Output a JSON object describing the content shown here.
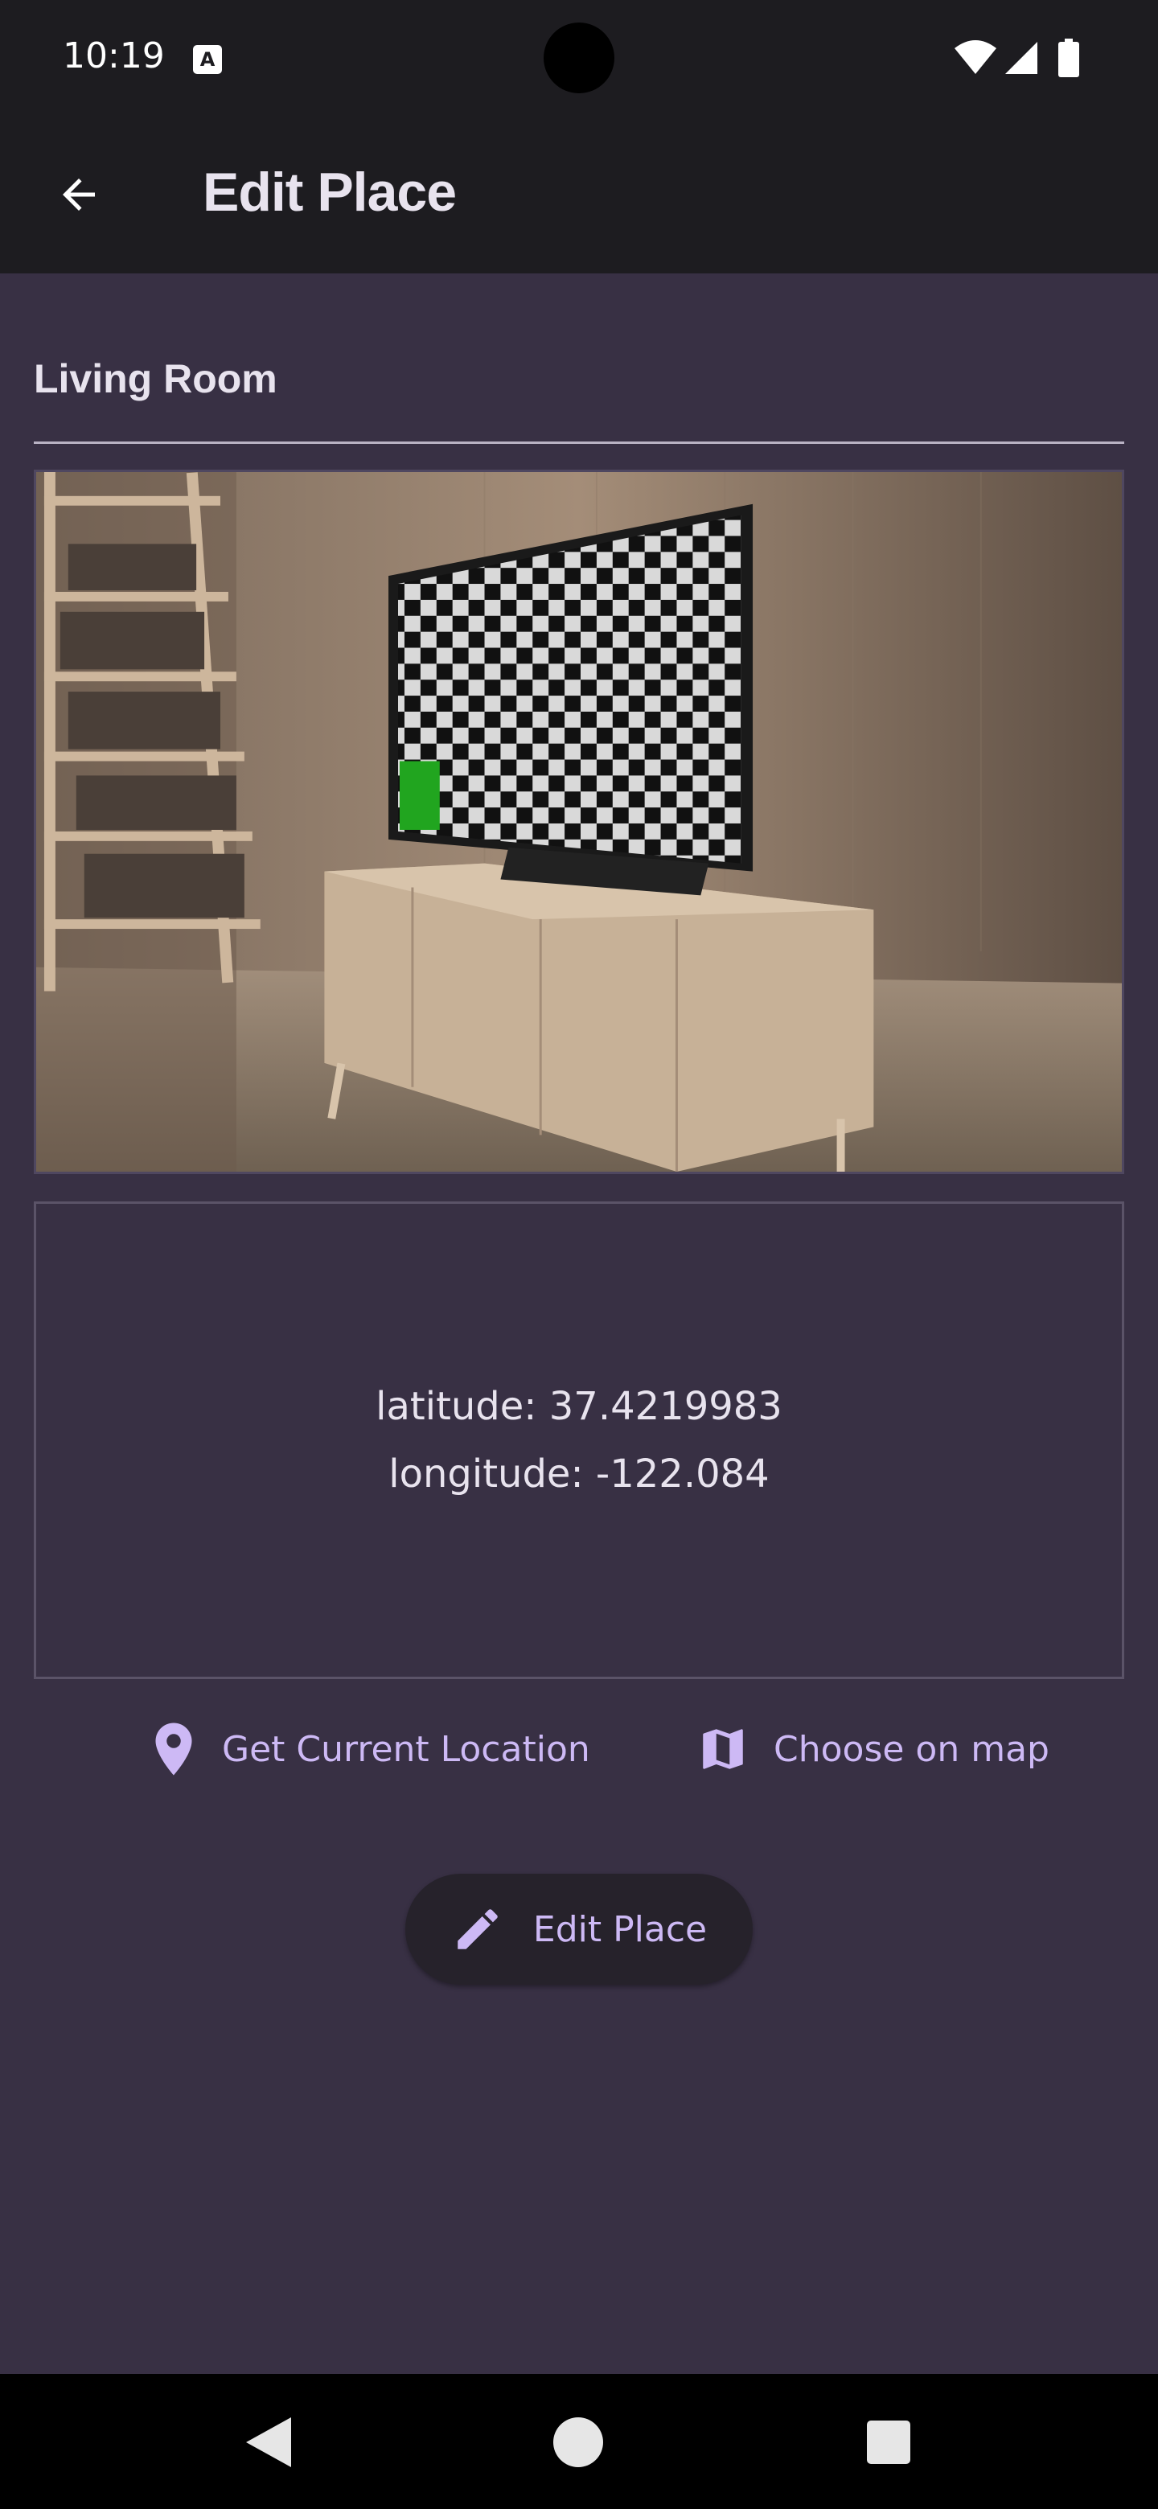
{
  "status_bar": {
    "time": "10:19",
    "notification_icon": "a-icon",
    "icons": [
      "wifi-icon",
      "signal-icon",
      "battery-icon"
    ]
  },
  "app_bar": {
    "back_icon": "arrow-back-icon",
    "title": "Edit Place"
  },
  "form": {
    "title_value": "Living Room",
    "image_description": "living-room-photo",
    "location": {
      "latitude_text": "latitude: 37.4219983",
      "longitude_text": "longitude: -122.084"
    },
    "actions": {
      "get_location_label": "Get Current Location",
      "get_location_icon": "location-pin-icon",
      "choose_map_label": "Choose on map",
      "choose_map_icon": "map-icon"
    },
    "submit": {
      "label": "Edit Place",
      "icon": "pencil-icon"
    }
  },
  "nav_bar": {
    "items": [
      "nav-back-icon",
      "nav-home-icon",
      "nav-recents-icon"
    ]
  },
  "colors": {
    "background": "#383044",
    "app_bar": "#1d1c20",
    "accent": "#cdb9f5",
    "button_bg": "#26222b"
  }
}
